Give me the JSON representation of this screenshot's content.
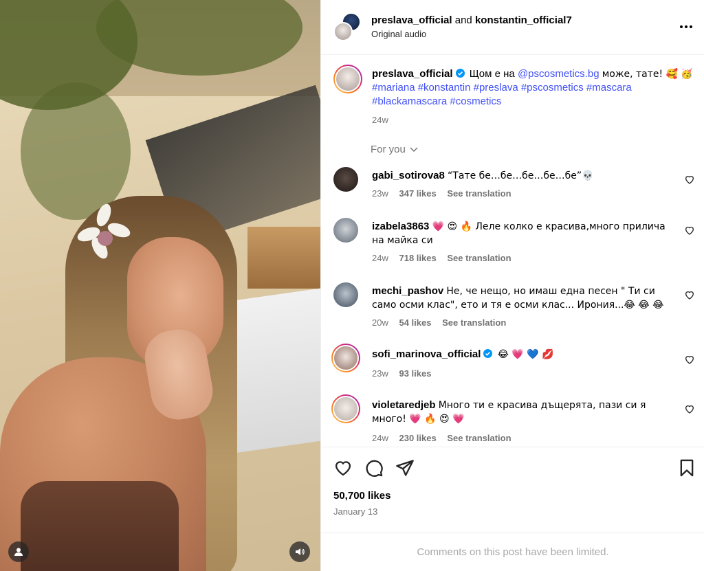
{
  "header": {
    "user1": "preslava_official",
    "joiner": "and",
    "user2": "konstantin_official7",
    "subtitle": "Original audio"
  },
  "caption": {
    "username": "preslava_official",
    "text_start": "Щом е на",
    "mention": "@pscosmetics.bg",
    "text_end": "може, тате! 🥰",
    "emoji2": "🥳",
    "hashtags": [
      "#mariana",
      "#konstantin",
      "#preslava",
      "#pscosmetics",
      "#mascara",
      "#blackamascara",
      "#cosmetics"
    ],
    "time": "24w"
  },
  "for_you": "For you",
  "comments": [
    {
      "username": "gabi_sotirova8",
      "text": "“Тате бе…бе…бе…бе…бе”💀",
      "time": "23w",
      "likes": "347 likes",
      "translate": "See translation"
    },
    {
      "username": "izabela3863",
      "text": "💗 😍 🔥 Леле колко е красива,много прилича на майка си",
      "time": "24w",
      "likes": "718 likes",
      "translate": "See translation"
    },
    {
      "username": "mechi_pashov",
      "text": "Не, че нещо, но имаш една песен \" Ти си само осми клас\", ето и тя е осми клас... Ирония...😂 😂 😂",
      "time": "20w",
      "likes": "54 likes",
      "translate": "See translation"
    },
    {
      "username": "sofi_marinova_official",
      "text": "😂 💗 💙 💋",
      "time": "23w",
      "likes": "93 likes",
      "translate": ""
    },
    {
      "username": "violetaredjeb",
      "text": "Много ти е красива дъщерята, пази си я много! 💗 🔥 😍 💗",
      "time": "24w",
      "likes": "230 likes",
      "translate": "See translation"
    }
  ],
  "post": {
    "likes": "50,700 likes",
    "date": "January 13",
    "limited": "Comments on this post have been limited."
  },
  "colors": {
    "link": "#4150f7",
    "verified": "#0095f6",
    "muted": "#737373",
    "border": "#efefef"
  }
}
